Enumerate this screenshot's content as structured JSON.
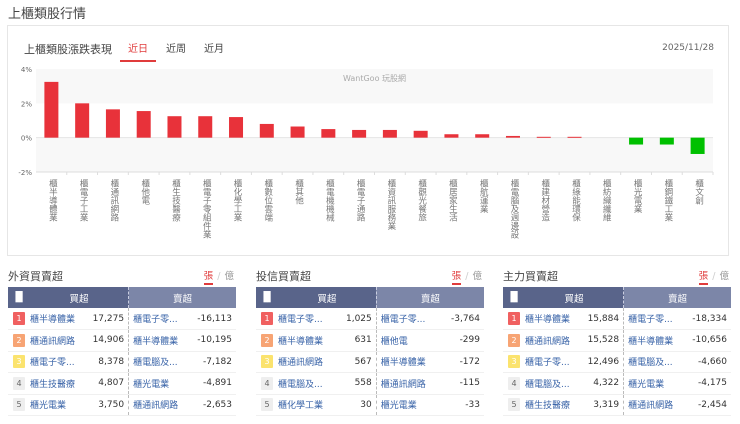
{
  "page_title": "上櫃類股行情",
  "card": {
    "title": "上櫃類股漲跌表現",
    "tabs": [
      "近日",
      "近周",
      "近月"
    ],
    "active_tab": 0,
    "date": "2025/11/28",
    "watermark": "WantGoo 玩股網"
  },
  "chart_data": {
    "type": "bar",
    "title": "上櫃類股漲跌表現",
    "ylabel": "%",
    "ylim": [
      -2,
      4
    ],
    "yticks": [
      "4%",
      "2%",
      "0%",
      "-2%"
    ],
    "categories": [
      "櫃半導體業",
      "櫃電子工業",
      "櫃通訊網路",
      "櫃他電",
      "櫃生技醫療",
      "櫃電子零組件業",
      "櫃化學工業",
      "櫃數位雲端",
      "櫃其他",
      "櫃電機機械",
      "櫃電子通路",
      "櫃資訊服務業",
      "櫃觀光餐旅",
      "櫃居家生活",
      "櫃航運業",
      "櫃電腦及週邊設",
      "櫃建材營造",
      "櫃綠能環保",
      "櫃紡織纖維",
      "櫃光電業",
      "櫃鋼鐵工業",
      "櫃文創"
    ],
    "values": [
      3.25,
      2.0,
      1.65,
      1.55,
      1.25,
      1.25,
      1.2,
      0.8,
      0.65,
      0.5,
      0.45,
      0.45,
      0.4,
      0.2,
      0.2,
      0.1,
      0.05,
      0.05,
      0,
      -0.4,
      -0.4,
      -0.95
    ],
    "colors": {
      "up": "#e8323a",
      "down": "#00c000"
    }
  },
  "panels": [
    {
      "title": "外資買賣超",
      "unit_on": "張",
      "unit_off": "億",
      "buy_header": "買超",
      "sell_header": "賣超",
      "rows": [
        {
          "rank": "1",
          "buy": "櫃半導體業",
          "buy_v": "17,275",
          "sell": "櫃電子零...",
          "sell_v": "-16,113"
        },
        {
          "rank": "2",
          "buy": "櫃通訊網路",
          "buy_v": "14,906",
          "sell": "櫃半導體業",
          "sell_v": "-10,195"
        },
        {
          "rank": "3",
          "buy": "櫃電子零...",
          "buy_v": "8,378",
          "sell": "櫃電腦及...",
          "sell_v": "-7,182"
        },
        {
          "rank": "4",
          "buy": "櫃生技醫療",
          "buy_v": "4,807",
          "sell": "櫃光電業",
          "sell_v": "-4,891"
        },
        {
          "rank": "5",
          "buy": "櫃光電業",
          "buy_v": "3,750",
          "sell": "櫃通訊網路",
          "sell_v": "-2,653"
        }
      ]
    },
    {
      "title": "投信買賣超",
      "unit_on": "張",
      "unit_off": "億",
      "buy_header": "買超",
      "sell_header": "賣超",
      "rows": [
        {
          "rank": "1",
          "buy": "櫃電子零...",
          "buy_v": "1,025",
          "sell": "櫃電子零...",
          "sell_v": "-3,764"
        },
        {
          "rank": "2",
          "buy": "櫃半導體業",
          "buy_v": "631",
          "sell": "櫃他電",
          "sell_v": "-299"
        },
        {
          "rank": "3",
          "buy": "櫃通訊網路",
          "buy_v": "567",
          "sell": "櫃半導體業",
          "sell_v": "-172"
        },
        {
          "rank": "4",
          "buy": "櫃電腦及...",
          "buy_v": "558",
          "sell": "櫃通訊網路",
          "sell_v": "-115"
        },
        {
          "rank": "5",
          "buy": "櫃化學工業",
          "buy_v": "30",
          "sell": "櫃光電業",
          "sell_v": "-33"
        }
      ]
    },
    {
      "title": "主力買賣超",
      "unit_on": "張",
      "unit_off": "億",
      "buy_header": "買超",
      "sell_header": "賣超",
      "rows": [
        {
          "rank": "1",
          "buy": "櫃半導體業",
          "buy_v": "15,884",
          "sell": "櫃電子零...",
          "sell_v": "-18,334"
        },
        {
          "rank": "2",
          "buy": "櫃通訊網路",
          "buy_v": "15,528",
          "sell": "櫃半導體業",
          "sell_v": "-10,656"
        },
        {
          "rank": "3",
          "buy": "櫃電子零...",
          "buy_v": "12,496",
          "sell": "櫃電腦及...",
          "sell_v": "-4,660"
        },
        {
          "rank": "4",
          "buy": "櫃電腦及...",
          "buy_v": "4,322",
          "sell": "櫃光電業",
          "sell_v": "-4,175"
        },
        {
          "rank": "5",
          "buy": "櫃生技醫療",
          "buy_v": "3,319",
          "sell": "櫃通訊網路",
          "sell_v": "-2,454"
        }
      ]
    }
  ],
  "rank_colors": [
    "#f06060",
    "#f7a474",
    "#fbe36e",
    "#eeeeee",
    "#eeeeee"
  ]
}
